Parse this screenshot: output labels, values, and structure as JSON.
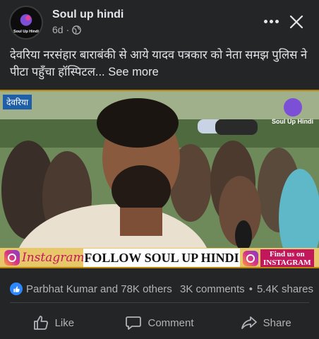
{
  "post": {
    "page_name": "Soul up hindi",
    "age": "6d",
    "meta_separator": "·",
    "avatar_text": "Soul Up Hindi",
    "caption": "देवरिया नरसंहार बाराबंकी से आये यादव पत्रकार को नेता समझ  पुलिस ने पीटा पहुँचा हॉस्पिटल...",
    "see_more": "See more"
  },
  "video": {
    "location_tag": "देवरिया",
    "watermark": "Soul Up Hindi",
    "banner": {
      "instagram_label": "Instagram",
      "follow_text": "FOLLOW SOUL UP HINDI",
      "find_line1": "Find us on",
      "find_line2": "INSTAGRAM"
    }
  },
  "stats": {
    "reactions": "Parbhat Kumar and 78K others",
    "comments": "3K comments",
    "separator": "•",
    "shares": "5.4K shares"
  },
  "actions": {
    "like": "Like",
    "comment": "Comment",
    "share": "Share"
  },
  "icons": {
    "more": "more-dots-icon",
    "close": "close-icon",
    "privacy": "globe-icon",
    "like": "thumbs-up-icon",
    "comment": "speech-bubble-icon",
    "share": "share-arrow-icon"
  },
  "colors": {
    "background": "#242526",
    "text_primary": "#e4e6eb",
    "text_secondary": "#b0b3b8",
    "like_blue": "#2d88ff",
    "banner_gold": "#e8c66a",
    "instagram_pink": "#c2185b"
  }
}
